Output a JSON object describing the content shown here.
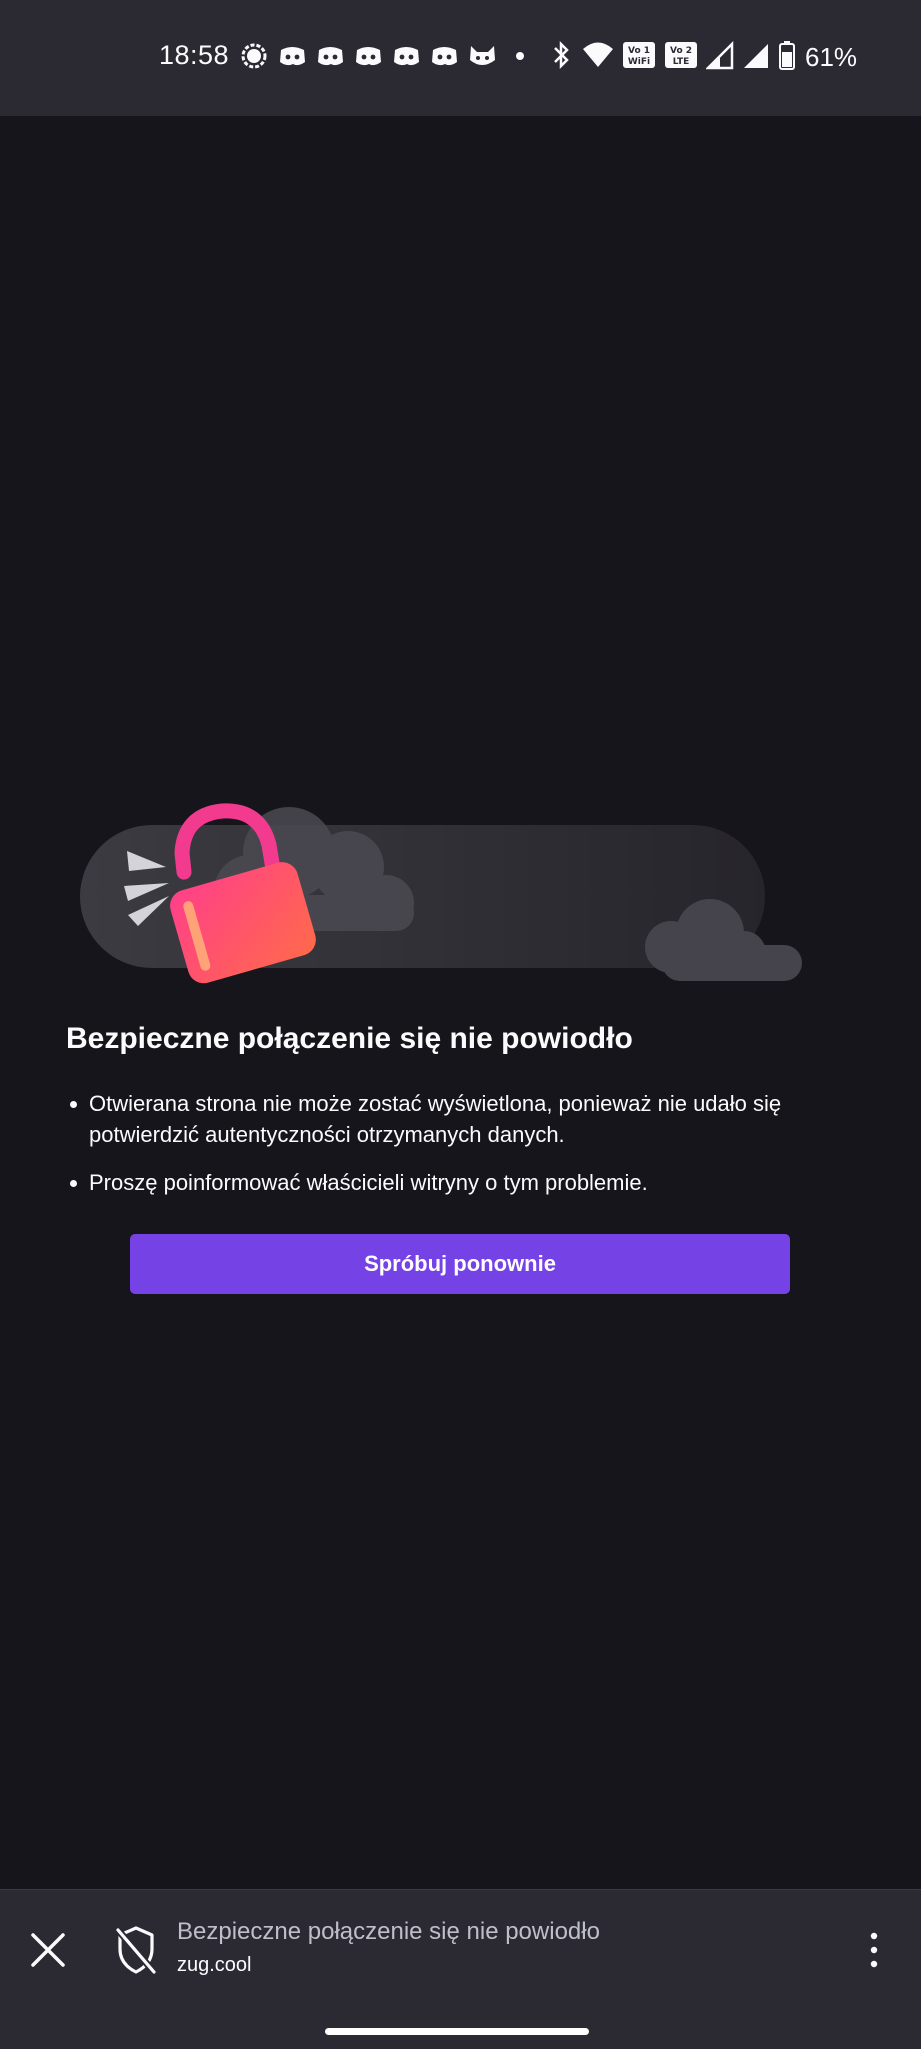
{
  "status_bar": {
    "time": "18:58",
    "notification_icons": [
      "signal-icon",
      "discord-icon",
      "discord-icon",
      "discord-icon",
      "discord-icon",
      "discord-icon",
      "cat-app-icon",
      "dot-icon"
    ],
    "system_icons": [
      "bluetooth-icon",
      "wifi-icon",
      "vowifi-icon",
      "volte-icon",
      "cell-signal-icon",
      "cell-signal-icon",
      "battery-icon"
    ],
    "vowifi_label": "Vo 1 WiFi",
    "volte_label": "Vo 2 LTE",
    "battery": "61%"
  },
  "error_page": {
    "title": "Bezpieczne połączenie się nie powiodło",
    "bullets": [
      "Otwierana strona nie może zostać wyświetlona, ponieważ nie udało się potwierdzić autentyczności otrzymanych danych.",
      "Proszę poinformować właścicieli witryny o tym problemie."
    ],
    "retry_label": "Spróbuj ponownie",
    "accent": "#7542e5"
  },
  "toolbar": {
    "page_title": "Bezpieczne połączenie się nie powiodło",
    "url": "zug.cool",
    "icons": [
      "close-icon",
      "shield-slash-icon",
      "more-vertical-icon"
    ]
  }
}
